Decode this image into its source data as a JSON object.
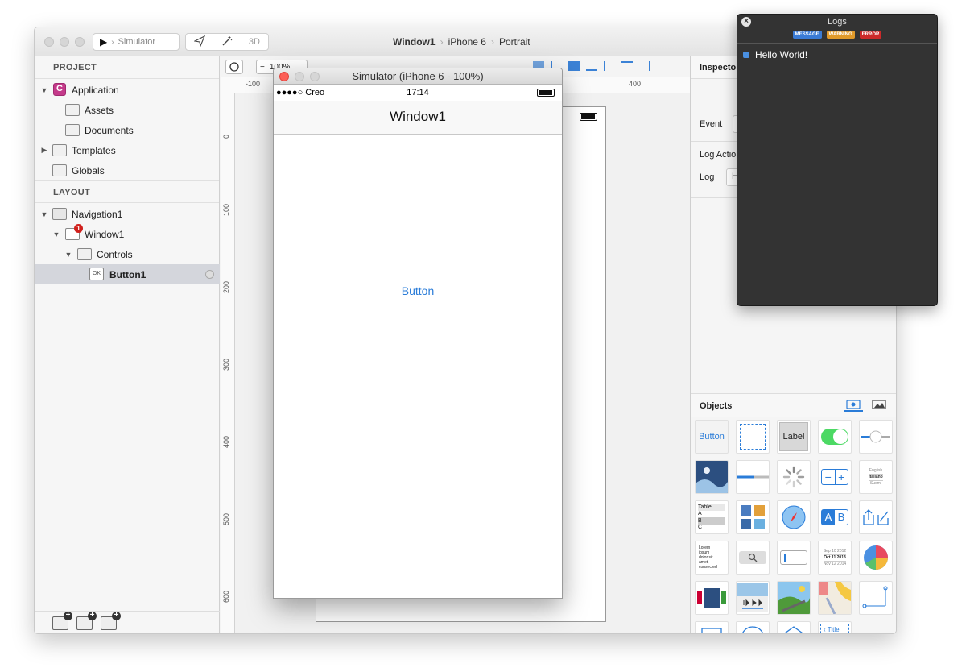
{
  "toolbar": {
    "run_target": "Simulator",
    "mode_3d": "3D",
    "path": [
      "Window1",
      "iPhone 6",
      "Portrait"
    ]
  },
  "project": {
    "section_title": "PROJECT",
    "items": [
      {
        "label": "Application",
        "icon": "app-icon"
      },
      {
        "label": "Assets",
        "icon": "folder-camera-icon"
      },
      {
        "label": "Documents",
        "icon": "folder-icon"
      },
      {
        "label": "Templates",
        "icon": "folder-grid-icon"
      },
      {
        "label": "Globals",
        "icon": "folder-globals-icon"
      }
    ]
  },
  "layout": {
    "section_title": "LAYOUT",
    "items": [
      {
        "label": "Navigation1",
        "icon": "navigation-icon"
      },
      {
        "label": "Window1",
        "icon": "window-icon",
        "badge": "1"
      },
      {
        "label": "Controls",
        "icon": "folder-icon"
      },
      {
        "label": "Button1",
        "icon": "button-ok-icon",
        "icon_text": "OK"
      }
    ]
  },
  "canvas": {
    "zoom": "100%",
    "ruler_top": [
      "-100",
      "400"
    ],
    "ruler_left": [
      "0",
      "100",
      "200",
      "300",
      "400",
      "500",
      "600"
    ]
  },
  "inspector": {
    "title": "Inspector",
    "event_label": "Event",
    "log_action_label": "Log Action",
    "log_label": "Log",
    "log_value": "H"
  },
  "objects": {
    "title": "Objects",
    "button_label": "Button",
    "label_label": "Label",
    "picker_items": [
      "English",
      "Italiano",
      "Suomi"
    ],
    "table_items": [
      "Table",
      "A",
      "B",
      "C"
    ],
    "text_lines": [
      "Lorem",
      "ipsum",
      "dolor sit",
      "amet,",
      "consected"
    ],
    "dates": [
      "Sep 10 2012",
      "Oct 11 2013",
      "Nov 12 2014"
    ],
    "segment_labels": [
      "A",
      "B"
    ],
    "nav_title": "Title"
  },
  "simulator": {
    "title": "Simulator (iPhone 6 - 100%)",
    "carrier": "●●●●○ Creo",
    "time": "17:14",
    "nav_title": "Window1",
    "button_label": "Button"
  },
  "logs": {
    "title": "Logs",
    "filters": [
      {
        "label": "MESSAGE",
        "color": "#3a7bd5"
      },
      {
        "label": "WARNING",
        "color": "#e09a2a"
      },
      {
        "label": "ERROR",
        "color": "#cc2a2a"
      }
    ],
    "entries": [
      "Hello World!"
    ]
  },
  "colors": {
    "accent": "#2a7cd8",
    "app_icon": "#c43a8a",
    "logs_bg": "#333333"
  }
}
